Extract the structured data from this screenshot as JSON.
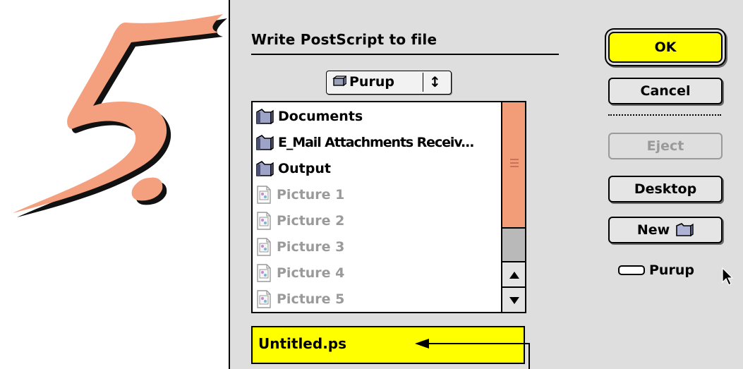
{
  "step_number": "5.",
  "dialog": {
    "title": "Write PostScript to file",
    "location_popup": {
      "label": "Purup",
      "icon": "disk-icon"
    },
    "file_list": [
      {
        "name": "Documents",
        "kind": "folder"
      },
      {
        "name": "E_Mail Attachments Receiv...",
        "kind": "folder"
      },
      {
        "name": "Output",
        "kind": "folder"
      },
      {
        "name": "Picture 1",
        "kind": "file"
      },
      {
        "name": "Picture 2",
        "kind": "file"
      },
      {
        "name": "Picture 3",
        "kind": "file"
      },
      {
        "name": "Picture 4",
        "kind": "file"
      },
      {
        "name": "Picture 5",
        "kind": "file"
      }
    ],
    "filename_value": "Untitled.ps",
    "buttons": {
      "ok": "OK",
      "cancel": "Cancel",
      "eject": "Eject",
      "desktop": "Desktop",
      "new": "New"
    },
    "volume_label": "Purup"
  },
  "colors": {
    "accent_yellow": "#ffff00",
    "scroll_thumb": "#f29c78",
    "numeral_fill": "#f4a07e",
    "dialog_bg": "#dedede",
    "disabled_text": "#9a9a9a"
  }
}
